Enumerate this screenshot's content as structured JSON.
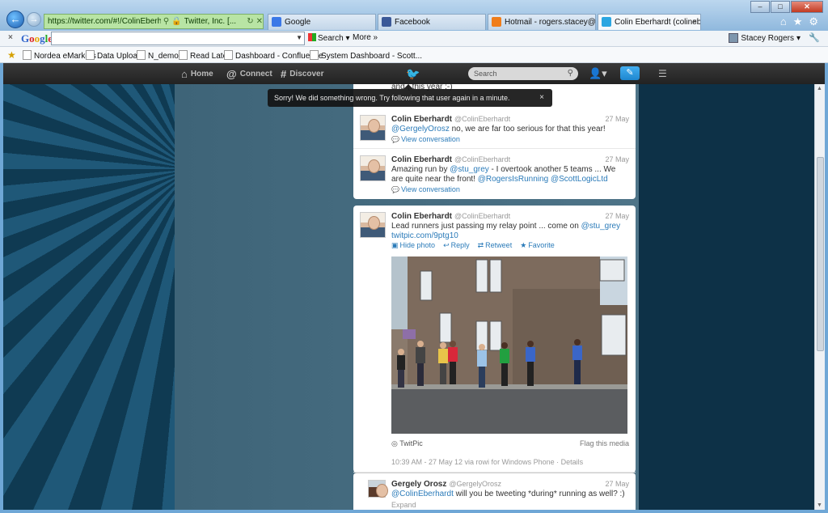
{
  "browser": {
    "address": {
      "url": "https://twitter.com/#!/ColinEberhardt",
      "org": "Twitter, Inc. [..."
    },
    "tabs": [
      {
        "label": "Google",
        "color": "#3b78e7"
      },
      {
        "label": "Facebook",
        "color": "#3b5998"
      },
      {
        "label": "Hotmail - rogers.stacey@hotm...",
        "color": "#f07d1a"
      },
      {
        "label": "Colin Eberhardt (colineberh...",
        "color": "#2ba6e1",
        "close": "×"
      }
    ],
    "window_buttons": {
      "minimize": "–",
      "maximize": "□",
      "close": "✕"
    },
    "ie_icons": {
      "home": "⌂",
      "favorites": "★",
      "tools": "⚙"
    }
  },
  "google_toolbar": {
    "close": "×",
    "logo": "Google",
    "search_button": "Search",
    "more": "More »",
    "user": "Stacey Rogers",
    "wrench": "🔧"
  },
  "favorites": {
    "items": [
      "Nordea eMarkets",
      "Data Upload",
      "N_demo2",
      "Read Later",
      "Dashboard - Confluence",
      "System Dashboard - Scott..."
    ]
  },
  "twitter_nav": {
    "home": "Home",
    "connect": "Connect",
    "discover": "Discover",
    "search_placeholder": "Search"
  },
  "error_tooltip": {
    "text": "Sorry! We did something wrong. Try following that user again in a minute.",
    "close": "×"
  },
  "timeline": {
    "partial_top": "and ( this year :-)",
    "tweets": [
      {
        "name": "Colin Eberhardt",
        "handle": "@ColinEberhardt",
        "date": "27 May",
        "mention": "@GergelyOrosz",
        "text": " no, we are far too serious for that this year!",
        "meta": "View conversation"
      },
      {
        "name": "Colin Eberhardt",
        "handle": "@ColinEberhardt",
        "date": "27 May",
        "text1": "Amazing run by ",
        "mention1": "@stu_grey",
        "text2": " - I overtook another 5 teams ... We are quite near the front! ",
        "mention2": "@RogersIsRunning",
        "mention3": "@ScottLogicLtd",
        "meta": "View conversation"
      },
      {
        "name": "Colin Eberhardt",
        "handle": "@ColinEberhardt",
        "date": "27 May",
        "text": "Lead runners just passing my relay point ... come on ",
        "mention": "@stu_grey",
        "link": "twitpic.com/9ptg10",
        "actions": {
          "hide_photo": "Hide photo",
          "reply": "Reply",
          "retweet": "Retweet",
          "favorite": "Favorite"
        },
        "photo_source": "TwitPic",
        "flag": "Flag this media",
        "timestamp": "10:39 AM - 27 May 12 via rowi for Windows Phone · Details"
      },
      {
        "name": "Gergely Orosz",
        "handle": "@GergelyOrosz",
        "date": "27 May",
        "mention": "@ColinEberhardt",
        "text": " will you be tweeting *during* running as well? :)",
        "meta": "Expand"
      }
    ]
  }
}
